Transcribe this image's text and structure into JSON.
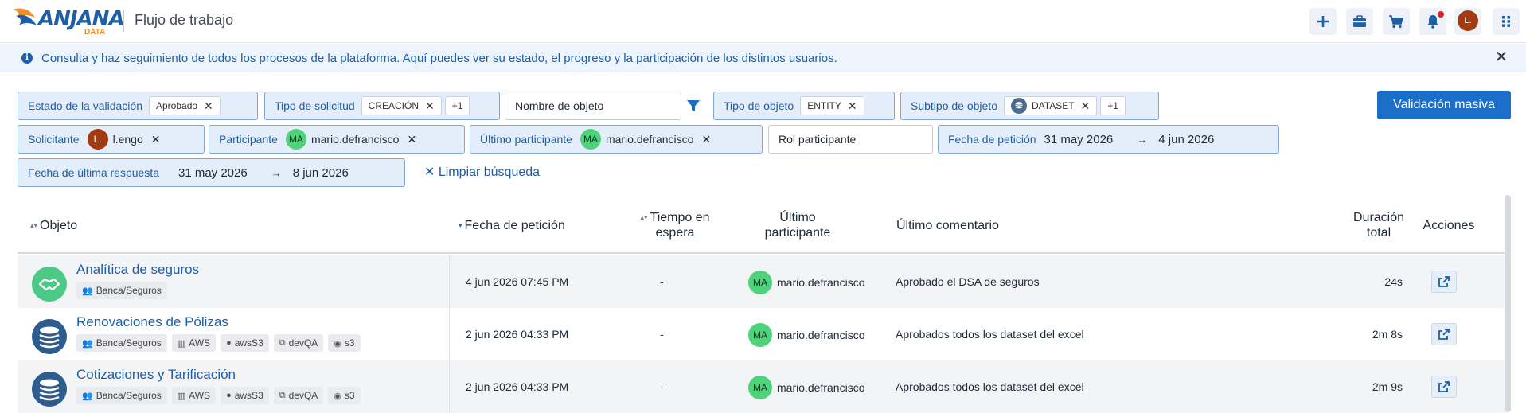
{
  "header": {
    "logo_text": "ANJANA",
    "logo_sub": "DATA",
    "title": "Flujo de trabajo",
    "avatar_initials": "L.",
    "icons": [
      "plus-icon",
      "briefcase-icon",
      "cart-icon",
      "bell-icon",
      "grid-icon"
    ]
  },
  "banner": {
    "text": "Consulta y haz seguimiento de todos los procesos de la plataforma. Aquí puedes ver su estado, el progreso y la participación de los distintos usuarios.",
    "close": "✕"
  },
  "filters": {
    "estado": {
      "label": "Estado de la validación",
      "tag": "Aprobado"
    },
    "tipo_solicitud": {
      "label": "Tipo de solicitud",
      "tag": "CREACIÓN",
      "more": "+1"
    },
    "nombre_objeto": {
      "placeholder": "Nombre de objeto"
    },
    "tipo_objeto": {
      "label": "Tipo de objeto",
      "tag": "ENTITY"
    },
    "subtipo_objeto": {
      "label": "Subtipo de objeto",
      "tag": "DATASET",
      "more": "+1"
    },
    "solicitante": {
      "label": "Solicitante",
      "avatar": "L.",
      "user": "l.engo"
    },
    "participante": {
      "label": "Participante",
      "avatar": "MA",
      "user": "mario.defrancisco"
    },
    "ultimo_participante": {
      "label": "Último participante",
      "avatar": "MA",
      "user": "mario.defrancisco"
    },
    "rol_participante": {
      "placeholder": "Rol participante"
    },
    "fecha_peticion": {
      "label": "Fecha de petición",
      "from": "31 may 2026",
      "to": "4 jun 2026"
    },
    "fecha_respuesta": {
      "label": "Fecha de última respuesta",
      "from": "31 may 2026",
      "to": "8 jun 2026"
    },
    "x": "✕",
    "arrow": "→"
  },
  "actions": {
    "validacion_masiva": "Validación masiva",
    "limpiar": "✕ Limpiar búsqueda"
  },
  "table": {
    "headers": {
      "objeto": "Objeto",
      "fecha": "Fecha de petición",
      "tiempo_1": "Tiempo en",
      "tiempo_2": "espera",
      "ultimo_1": "Último",
      "ultimo_2": "participante",
      "comentario": "Último comentario",
      "duracion_1": "Duración",
      "duracion_2": "total",
      "acciones": "Acciones"
    },
    "rows": [
      {
        "name": "Analítica de seguros",
        "tags": [
          "Banca/Seguros"
        ],
        "fecha": "4 jun 2026 07:45 PM",
        "espera": "-",
        "avatar": "MA",
        "participante": "mario.defrancisco",
        "comentario": "Aprobado el DSA de seguros",
        "duracion": "24s"
      },
      {
        "name": "Renovaciones de Pólizas",
        "tags": [
          "Banca/Seguros",
          "AWS",
          "awsS3",
          "devQA",
          "s3"
        ],
        "fecha": "2 jun 2026 04:33 PM",
        "espera": "-",
        "avatar": "MA",
        "participante": "mario.defrancisco",
        "comentario": "Aprobados todos los dataset del excel",
        "duracion": "2m 8s"
      },
      {
        "name": "Cotizaciones y Tarificación",
        "tags": [
          "Banca/Seguros",
          "AWS",
          "awsS3",
          "devQA",
          "s3"
        ],
        "fecha": "2 jun 2026 04:33 PM",
        "espera": "-",
        "avatar": "MA",
        "participante": "mario.defrancisco",
        "comentario": "Aprobados todos los dataset del excel",
        "duracion": "2m 9s"
      }
    ]
  },
  "colors": {
    "primary": "#1b6fc9",
    "link": "#1d5fa8",
    "chip_bg": "#e4eefa",
    "avatar_green": "#4ed37c",
    "avatar_brown": "#a23a12"
  }
}
